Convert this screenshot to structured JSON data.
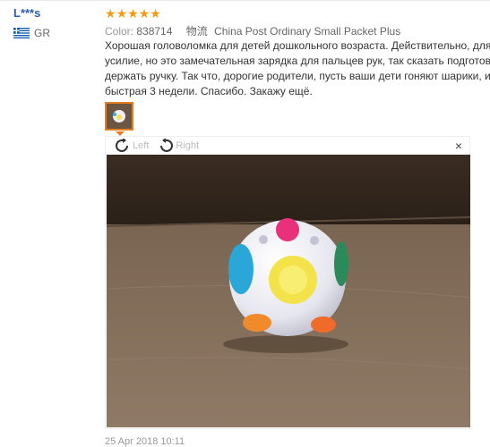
{
  "reviewer": {
    "name": "L***s",
    "country": "GR"
  },
  "rating": {
    "stars": 5,
    "max": 5
  },
  "meta": {
    "color_label": "Color:",
    "color_value": "838714",
    "shipping_label": "物流",
    "shipping_value": "China Post Ordinary Small Packet Plus"
  },
  "review_lines": [
    "Хорошая головоломка для детей дошкольного возраста. Действительно, для перемещения шариков нужно",
    "усилие, но это замечательная зарядка для пальцев рук, так сказать подготовка к школе, когда придется",
    "держать ручку. Так что, дорогие родители, пусть ваши дети гоняют шарики, исполь",
    "быстрая 3 недели. Спасибо. Закажу ещё."
  ],
  "viewer": {
    "left_label": "Left",
    "right_label": "Right",
    "close_symbol": "×"
  },
  "date": "25 Apr 2018 10:11",
  "colors": {
    "accent": "#e67e22",
    "star": "#f39c12",
    "link": "#2a5db0"
  },
  "icons": {
    "flag": "greece-flag-icon",
    "rotate_left": "rotate-left-icon",
    "rotate_right": "rotate-right-icon",
    "close": "close-icon"
  }
}
